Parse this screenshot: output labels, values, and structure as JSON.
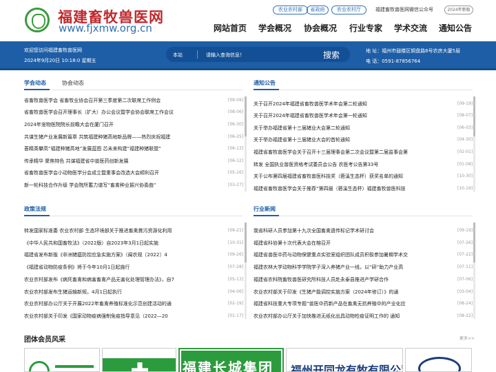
{
  "header": {
    "logo_cn": "福建畜牧兽医网",
    "logo_url": "www.fjxmw.org.cn",
    "top_links": [
      "农业农村部",
      "省政府",
      "农业农村厅"
    ],
    "wechat": "福建畜牧兽医网微信公众号",
    "new_version": "2024年新版",
    "nav": [
      "网站首页",
      "学会概况",
      "协会概况",
      "行业专家",
      "学术交流",
      "通知公告"
    ]
  },
  "banner": {
    "welcome": "欢迎您访问福建畜牧兽医网",
    "date": "2024年9月20日 10:18:0 星期五",
    "search_scope": "本站",
    "search_placeholder": "请输入查询信息！",
    "search_button": "搜索",
    "address": "地 址：福州市鼓楼区铜盘路6号农房大厦5层",
    "phone": "电 话：0591-87856764"
  },
  "news": {
    "tab_active": "学会动态",
    "tab_other": "协会动态",
    "items": [
      {
        "t": "省畜牧兽医学会 省畜牧业协会召开第三季度第二次联席工作例会",
        "d": "[09-09]"
      },
      {
        "t": "省畜牧兽医学会召开理事长（扩大）办公会议暨学会协会联席工作会议",
        "d": "[08-06]"
      },
      {
        "t": "2024年宠物医院院长前瞻大会在厦门召开",
        "d": "[06-30]"
      },
      {
        "t": "共谋生猪产业发展新篇章 共筑福建种猪高地新品牌——热烈庆祝福建",
        "d": "[06-25]"
      },
      {
        "t": "荟精英攀高“福建种猪高地”发展蓝图 芯未来构建“福建种猪联盟”",
        "d": "[06-13]"
      },
      {
        "t": "传承精华 聚焦特色 共谋福建省中兽医药创新发展",
        "d": "[06-12]"
      },
      {
        "t": "省畜牧兽医学会小动物医学分会成立暨重事会改选大会顺利召开",
        "d": "[05-16]"
      },
      {
        "t": "新一轮科技合作升级 学会院所蓄力谱写“畜禽种业振兴协奏曲”",
        "d": "[03-27]"
      }
    ]
  },
  "notice": {
    "title": "通知公告",
    "items": [
      {
        "t": "关于召开2024年福建省畜牧兽医学术年会第二轮通知",
        "d": "[09-19]"
      },
      {
        "t": "关于召开2024年福建省畜牧兽医学术年会第一轮通知",
        "d": "[08-07]"
      },
      {
        "t": "关于举办福建省第十三届猪业大会第二轮通知",
        "d": "[06-03]"
      },
      {
        "t": "关于举办福建省第十三届猪业大会的首轮通知",
        "d": "[04-30]"
      },
      {
        "t": "福建省畜牧兽医学会关于召开十三届理事会第二次会议暨第二届监事会第",
        "d": "[02-01]"
      },
      {
        "t": "转发 全国执业兽医资格考试委员会公告 农医考公告第33号",
        "d": "[01-08]"
      },
      {
        "t": "关于公布第四届福建省畜牧兽医科技奖（菪溪生态杯）获奖名单的通知",
        "d": "[10-30]"
      },
      {
        "t": "福建省畜牧兽医学会关于推荐“第四届（菪溪生态杯）福建畜牧兽医科技",
        "d": "[10-19]"
      }
    ]
  },
  "policy": {
    "title": "政策法规",
    "items": [
      {
        "t": "转发国家标准委 农业农村部 生态环境部关于推进畜禽粪污资源化利用",
        "d": "[09-21]"
      },
      {
        "t": "《中华人民共和国畜牧法》（2022版）自2023年3月1日起实施",
        "d": "[10-31]"
      },
      {
        "t": "福建省发布新版《非洲猪瘟防控应急实施方案》（闽农规〔2022〕4",
        "d": "[09-26]"
      },
      {
        "t": "《福建省动物防疫条例》将于今年10月1日起施行",
        "d": "[07-28]"
      },
      {
        "t": "农业农村部发布《病死畜禽和病害畜禽产品无害化处理管理办法》，自7",
        "d": "[05-13]"
      },
      {
        "t": "农业农村部发布生猪运输新规，4月1日起执行",
        "d": "[04-06]"
      },
      {
        "t": "农业农村部办公厅关于开展2022年畜禽养殖标准化示范创建活动的通",
        "d": "[02-19]"
      },
      {
        "t": "农业农村部关于印发《国家动物疫病强制免疫指导意见（2022—20",
        "d": "[01-17]"
      }
    ]
  },
  "industry": {
    "title": "行业新闻",
    "items": [
      {
        "t": "我省科研人员参加第十九次全国畜禽遗传标记学术研讨会",
        "d": "[09-19]"
      },
      {
        "t": "福建省科协第十次代表大会在榕召开",
        "d": "[07-26]"
      },
      {
        "t": "福建省兽医中药与动物保健重点实验室组织团队成员积极参加暑期学术交",
        "d": "[07-22]"
      },
      {
        "t": "福建农林大学动物科学学院学子深入养猪产业一线，以“研”助力产业高",
        "d": "[07-11]"
      },
      {
        "t": "福建省农科院畜牧兽医研究所科技人员赴永泰县推进产学研合作",
        "d": "[07-06]"
      },
      {
        "t": "农业农村部关于印发《生猪产能调控实施方案（2024年修订）》的通",
        "d": "[03-04]"
      },
      {
        "t": "福建省科技重大专项专题“兽医中药新产品在畜禽无抗养殖中的产业化应",
        "d": "[08-24]"
      },
      {
        "t": "农业农村部办公厅关于加快推进无纸化出具动物检疫证明工作的 通知",
        "d": "[08-22]"
      }
    ]
  },
  "members": {
    "title": "团体会员风采",
    "more": "更多>>",
    "tile3": "福建长城集团",
    "tile4": "福州开同龙有牧有限公司"
  },
  "colors": {
    "brand_blue": "#1d5ea6",
    "logo_red": "#c0282d",
    "green": "#2c9b3d"
  }
}
